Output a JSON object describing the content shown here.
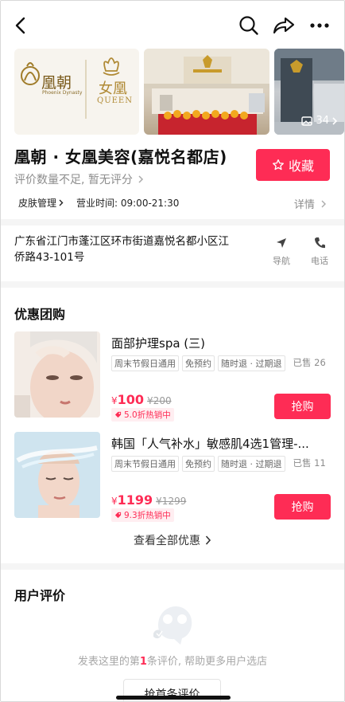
{
  "gallery": {
    "logo_text_left": "凰朝",
    "logo_sub_left": "Phoenix Dynasty",
    "logo_text_right": "女凰",
    "logo_sub_right": "QUEEN",
    "photo_count": "34"
  },
  "store": {
    "name": "凰朝 · 女凰美容(嘉悦名都店)",
    "rating_text": "评价数量不足, 暂无评分",
    "favorite_label": "收藏",
    "category": "皮肤管理",
    "hours": "营业时间: 09:00-21:30",
    "detail_label": "详情",
    "address": "广东省江门市蓬江区环市街道嘉悦名都小区江侨路43-101号",
    "nav_label": "导航",
    "phone_label": "电话"
  },
  "deals": {
    "section_title": "优惠团购",
    "items": [
      {
        "title": "面部护理spa (三)",
        "tags": [
          "周末节假日通用",
          "免预约",
          "随时退 · 过期退"
        ],
        "sold": "已售 26",
        "currency": "¥",
        "price": "100",
        "original": "¥200",
        "discount": "5.0折热销中",
        "buy": "抢购"
      },
      {
        "title": "韩国「人气补水」敏感肌4选1管理-...",
        "tags": [
          "周末节假日通用",
          "免预约",
          "随时退 · 过期退"
        ],
        "sold": "已售 11",
        "currency": "¥",
        "price": "1199",
        "original": "¥1299",
        "discount": "9.3折热销中",
        "buy": "抢购"
      }
    ],
    "see_all": "查看全部优惠"
  },
  "reviews": {
    "section_title": "用户评价",
    "prompt_before": "发表这里的第",
    "prompt_num": "1",
    "prompt_after": "条评价, 帮助更多用户选店",
    "first_review_button": "抢首条评价"
  },
  "colors": {
    "accent": "#fe2c55",
    "muted": "#8c8c8c",
    "divider": "#f5f5f5"
  },
  "icons": [
    "back-icon",
    "search-icon",
    "share-icon",
    "more-icon",
    "image-icon",
    "star-icon",
    "navigation-icon",
    "phone-icon",
    "ticket-icon",
    "empty-review-icon"
  ]
}
